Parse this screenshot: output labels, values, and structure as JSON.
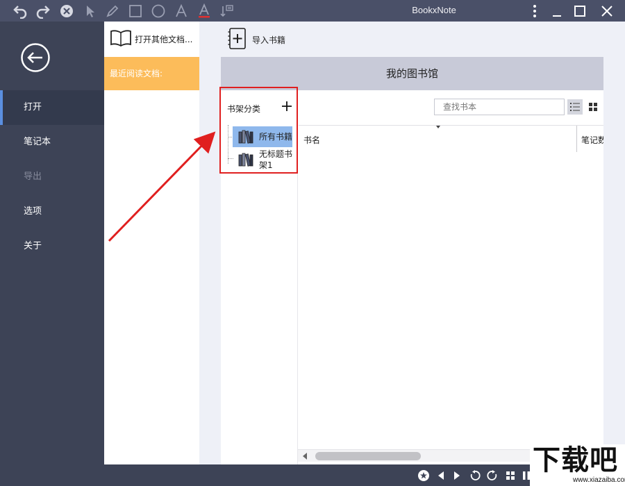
{
  "titlebar": {
    "app_title": "BookxNote"
  },
  "nav": {
    "items": [
      {
        "label": "打开",
        "state": "active"
      },
      {
        "label": "笔记本",
        "state": "normal"
      },
      {
        "label": "导出",
        "state": "disabled"
      },
      {
        "label": "选项",
        "state": "normal"
      },
      {
        "label": "关于",
        "state": "normal"
      }
    ]
  },
  "recent": {
    "open_other_label": "打开其他文档...",
    "header": "最近阅读文档:"
  },
  "main": {
    "import_label": "导入书籍",
    "library_title": "我的图书馆",
    "shelf_title": "书架分类",
    "shelves": [
      {
        "label": "所有书籍",
        "selected": true
      },
      {
        "label": "无标题书架1",
        "selected": false
      }
    ],
    "search_placeholder": "查找书本",
    "columns": [
      "书名",
      "笔记数"
    ]
  },
  "colors": {
    "accent_orange": "#fcbc5a",
    "nav_bg": "#3d4356",
    "highlight_red": "#e01f1f",
    "selected_blue": "#8fb8ec"
  },
  "watermark": {
    "text": "下载吧",
    "url": "www.xiazaiba.com"
  }
}
